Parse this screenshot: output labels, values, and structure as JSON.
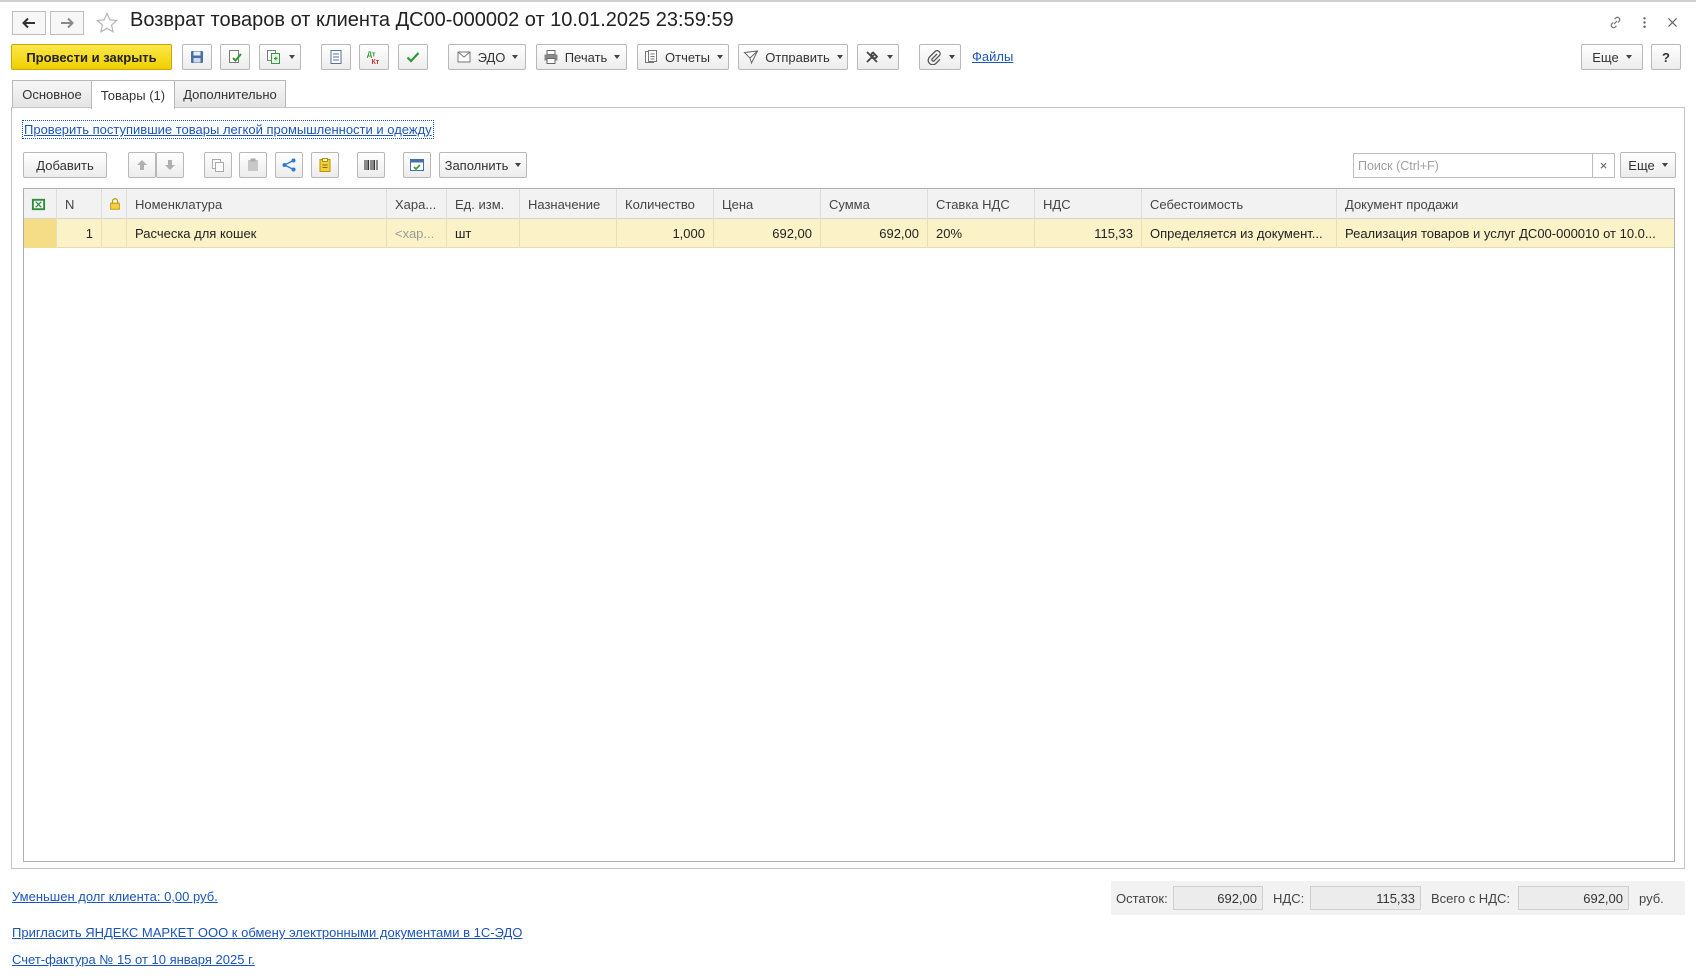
{
  "window": {
    "title": "Возврат товаров от клиента ДС00-000002 от 10.01.2025 23:59:59"
  },
  "toolbar": {
    "post_close_label": "Провести и закрыть",
    "edo_label": "ЭДО",
    "print_label": "Печать",
    "reports_label": "Отчеты",
    "send_label": "Отправить",
    "files_label": "Файлы",
    "more_label": "Еще",
    "help_label": "?"
  },
  "tabs": [
    {
      "label": "Основное"
    },
    {
      "label": "Товары (1)"
    },
    {
      "label": "Дополнительно"
    }
  ],
  "goods": {
    "check_link": "Проверить поступившие товары легкой промышленности и одежду",
    "add_label": "Добавить",
    "fill_label": "Заполнить",
    "search_placeholder": "Поиск (Ctrl+F)",
    "clear_label": "×",
    "more_label": "Еще",
    "columns": [
      "N",
      "Номенклатура",
      "Хара...",
      "Ед. изм.",
      "Назначение",
      "Количество",
      "Цена",
      "Сумма",
      "Ставка НДС",
      "НДС",
      "Себестоимость",
      "Документ продажи"
    ],
    "rows": [
      {
        "n": "1",
        "nomenclature": "Расческа для кошек",
        "characteristic": "<хар...",
        "unit": "шт",
        "purpose": "",
        "quantity": "1,000",
        "price": "692,00",
        "sum": "692,00",
        "vat_rate": "20%",
        "vat": "115,33",
        "cost": "Определяется из документ...",
        "sale_doc": "Реализация товаров и услуг ДС00-000010 от 10.0..."
      }
    ]
  },
  "footer": {
    "debt_link": "Уменьшен долг клиента: 0,00 руб.",
    "invite_link": "Пригласить ЯНДЕКС МАРКЕТ ООО к обмену электронными документами в 1С-ЭДО",
    "invoice_link": "Счет-фактура № 15 от 10 января 2025 г.",
    "remainder_label": "Остаток:",
    "remainder_value": "692,00",
    "vat_label": "НДС:",
    "vat_value": "115,33",
    "total_label": "Всего с НДС:",
    "total_value": "692,00",
    "currency": "руб."
  },
  "colors": {
    "primary_button": "#f0cf00",
    "selected_row": "#fbf2c8",
    "link": "#1a55b8"
  }
}
